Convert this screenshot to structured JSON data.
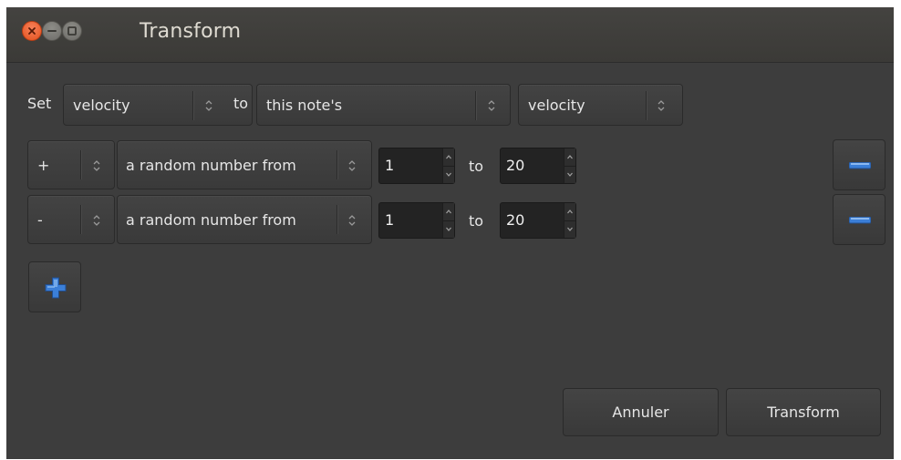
{
  "window": {
    "title": "Transform",
    "controls": [
      "close-icon",
      "minimize-icon",
      "maximize-icon"
    ]
  },
  "set_row": {
    "set_label": "Set",
    "property": "velocity",
    "to_label": "to",
    "source": "this note's",
    "source_property": "velocity"
  },
  "rows": [
    {
      "operator": "+",
      "value_type": "a random number from",
      "from": "1",
      "to_label": "to",
      "to": "20"
    },
    {
      "operator": "-",
      "value_type": "a random number from",
      "from": "1",
      "to_label": "to",
      "to": "20"
    }
  ],
  "icons": {
    "remove": "minus-icon",
    "add": "plus-icon",
    "combo_arrow": "updown-chevron-icon"
  },
  "colors": {
    "close_button": "#e3501c",
    "icon_blue": "#3b7fd8",
    "background": "#3d3d3d"
  },
  "footer": {
    "cancel_label": "Annuler",
    "transform_label": "Transform"
  }
}
